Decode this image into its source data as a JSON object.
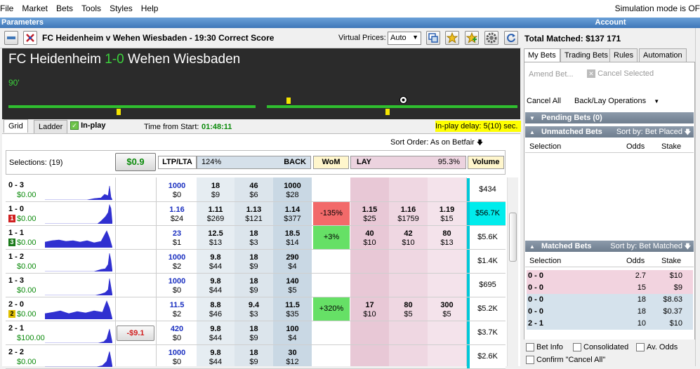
{
  "menu": [
    "File",
    "Market",
    "Bets",
    "Tools",
    "Styles",
    "Help"
  ],
  "simulation": "Simulation mode is OF",
  "sections": {
    "left": "Parameters",
    "right": "Account"
  },
  "toolbar": {
    "market_title": "FC Heidenheim v Wehen Wiesbaden - 19:30 Correct Score",
    "virtual_prices_label": "Virtual Prices:",
    "virtual_prices_value": "Auto",
    "total_matched": "Total Matched: $137 171"
  },
  "score": {
    "home": "FC Heidenheim",
    "result": "1-0",
    "away": "Wehen Wiesbaden",
    "minute": "90'"
  },
  "tabs": {
    "grid": "Grid",
    "ladder": "Ladder",
    "inplay": "In-play"
  },
  "time": {
    "label": "Time from Start:",
    "value": "01:48:11"
  },
  "inplay_delay": "In-play delay: 5(10) sec.",
  "sort_order": "Sort Order: As on Betfair",
  "grid_header": {
    "selections": "Selections: (19)",
    "pl_button": "$0.9",
    "ltp": "LTP/LTA",
    "back_pct": "124%",
    "back": "BACK",
    "wom": "WoM",
    "lay": "LAY",
    "lay_pct": "95.3%",
    "volume": "Volume"
  },
  "rows": [
    {
      "name": "0 - 3",
      "pl": "$0.00",
      "badge": "",
      "hedge": "",
      "ltp": "1000",
      "lta": "$0",
      "b3": "18",
      "b3s": "$9",
      "b2": "46",
      "b2s": "$6",
      "b1": "1000",
      "b1s": "$28",
      "wom": "",
      "l1": "",
      "l1s": "",
      "l2": "",
      "l2s": "",
      "l3": "",
      "l3s": "",
      "vol": "$434"
    },
    {
      "name": "1 - 0",
      "pl": "$0.00",
      "badge": "1",
      "hedge": "",
      "ltp": "1.16",
      "lta": "$24",
      "b3": "1.11",
      "b3s": "$269",
      "b2": "1.13",
      "b2s": "$121",
      "b1": "1.14",
      "b1s": "$377",
      "wom": "-135%",
      "l1": "1.15",
      "l1s": "$25",
      "l2": "1.16",
      "l2s": "$1759",
      "l3": "1.19",
      "l3s": "$15",
      "vol": "$56.7K"
    },
    {
      "name": "1 - 1",
      "pl": "$0.00",
      "badge": "3",
      "hedge": "",
      "ltp": "23",
      "lta": "$1",
      "b3": "12.5",
      "b3s": "$13",
      "b2": "18",
      "b2s": "$3",
      "b1": "18.5",
      "b1s": "$14",
      "wom": "+3%",
      "l1": "40",
      "l1s": "$10",
      "l2": "42",
      "l2s": "$10",
      "l3": "80",
      "l3s": "$13",
      "vol": "$5.6K"
    },
    {
      "name": "1 - 2",
      "pl": "$0.00",
      "badge": "",
      "hedge": "",
      "ltp": "1000",
      "lta": "$2",
      "b3": "9.8",
      "b3s": "$44",
      "b2": "18",
      "b2s": "$9",
      "b1": "290",
      "b1s": "$4",
      "wom": "",
      "l1": "",
      "l1s": "",
      "l2": "",
      "l2s": "",
      "l3": "",
      "l3s": "",
      "vol": "$1.4K"
    },
    {
      "name": "1 - 3",
      "pl": "$0.00",
      "badge": "",
      "hedge": "",
      "ltp": "1000",
      "lta": "$0",
      "b3": "9.8",
      "b3s": "$44",
      "b2": "18",
      "b2s": "$9",
      "b1": "140",
      "b1s": "$5",
      "wom": "",
      "l1": "",
      "l1s": "",
      "l2": "",
      "l2s": "",
      "l3": "",
      "l3s": "",
      "vol": "$695"
    },
    {
      "name": "2 - 0",
      "pl": "$0.00",
      "badge": "2",
      "hedge": "",
      "ltp": "11.5",
      "lta": "$2",
      "b3": "8.8",
      "b3s": "$46",
      "b2": "9.4",
      "b2s": "$3",
      "b1": "11.5",
      "b1s": "$35",
      "wom": "+320%",
      "l1": "17",
      "l1s": "$10",
      "l2": "80",
      "l2s": "$5",
      "l3": "300",
      "l3s": "$5",
      "vol": "$5.2K"
    },
    {
      "name": "2 - 1",
      "pl": "$100.00",
      "badge": "",
      "hedge": "-$9.1",
      "ltp": "420",
      "lta": "$0",
      "b3": "9.8",
      "b3s": "$44",
      "b2": "18",
      "b2s": "$9",
      "b1": "100",
      "b1s": "$4",
      "wom": "",
      "l1": "",
      "l1s": "",
      "l2": "",
      "l2s": "",
      "l3": "",
      "l3s": "",
      "vol": "$3.7K"
    },
    {
      "name": "2 - 2",
      "pl": "$0.00",
      "badge": "",
      "hedge": "",
      "ltp": "1000",
      "lta": "$0",
      "b3": "9.8",
      "b3s": "$44",
      "b2": "18",
      "b2s": "$9",
      "b1": "30",
      "b1s": "$12",
      "wom": "",
      "l1": "",
      "l1s": "",
      "l2": "",
      "l2s": "",
      "l3": "",
      "l3s": "",
      "vol": "$2.6K"
    }
  ],
  "right": {
    "tabs": [
      "My Bets",
      "Trading Bets",
      "Rules",
      "Automation"
    ],
    "amend": "Amend Bet...",
    "cancel_selected": "Cancel Selected",
    "cancel_all": "Cancel All",
    "backlay_ops": "Back/Lay Operations",
    "pending": "Pending Bets (0)",
    "unmatched": "Unmatched Bets",
    "unmatched_sort": "Sort by: Bet Placed",
    "matched": "Matched Bets",
    "matched_sort": "Sort by: Bet Matched",
    "col_selection": "Selection",
    "col_odds": "Odds",
    "col_stake": "Stake",
    "matched_rows": [
      {
        "sel": "0 - 0",
        "odds": "2.7",
        "stake": "$10",
        "side": "lay"
      },
      {
        "sel": "0 - 0",
        "odds": "15",
        "stake": "$9",
        "side": "lay"
      },
      {
        "sel": "0 - 0",
        "odds": "18",
        "stake": "$8.63",
        "side": "back"
      },
      {
        "sel": "0 - 0",
        "odds": "18",
        "stake": "$0.37",
        "side": "back"
      },
      {
        "sel": "2 - 1",
        "odds": "10",
        "stake": "$10",
        "side": "back"
      }
    ],
    "checkboxes": [
      "Bet Info",
      "Consolidated",
      "Av. Odds",
      "Confirm \"Cancel All\""
    ]
  }
}
